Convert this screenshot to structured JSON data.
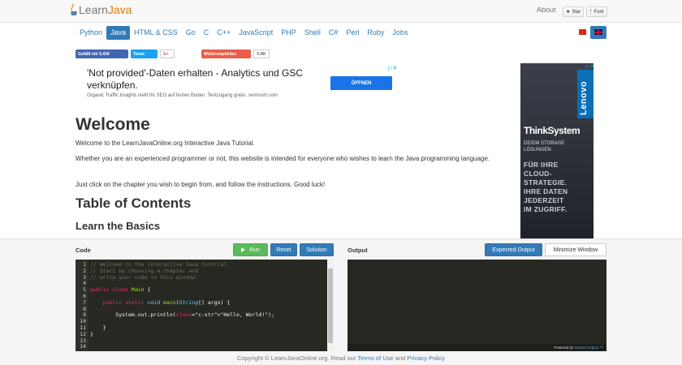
{
  "header": {
    "logo_learn": "Learn",
    "logo_java": "Java",
    "about": "About",
    "star": "Star",
    "fork": "Fork"
  },
  "languages": [
    "Python",
    "Java",
    "HTML & CSS",
    "Go",
    "C",
    "C++",
    "JavaScript",
    "PHP",
    "Shell",
    "C#",
    "Perl",
    "Ruby",
    "Jobs"
  ],
  "active_language": "Java",
  "social": {
    "facebook": "Gefällt mir 5.434",
    "twitter": "Tweet",
    "gplus": "G+",
    "xing": "Weiterempfehlen",
    "xing_count": "5.8K"
  },
  "ad_top": {
    "title": "'Not provided'-Daten erhalten - Analytics und GSC verknüpfen.",
    "subtitle": "Organic Traffic Insights stellt Ihr SEO auf festen Boden. Testzugang gratis. semrush.com",
    "button": "ÖFFNEN"
  },
  "content": {
    "title": "Welcome",
    "p1": "Welcome to the LearnJavaOnline.org Interactive Java Tutorial.",
    "p2": "Whether you are an experienced programmer or not, this website is intended for everyone who wishes to learn the Java programming language.",
    "p3": "Just click on the chapter you wish to begin from, and follow the instructions. Good luck!",
    "toc": "Table of Contents",
    "basics": "Learn the Basics"
  },
  "side_ad": {
    "brand": "Lenovo",
    "product": "ThinkSystem",
    "sub1": "DE/DM STORAGE",
    "sub2": "LÖSUNGEN",
    "slogan1": "FÜR IHRE",
    "slogan2": "CLOUD-",
    "slogan3": "STRATEGIE.",
    "slogan4": "IHRE DATEN",
    "slogan5": "JEDERZEIT",
    "slogan6": "IM ZUGRIFF."
  },
  "editor": {
    "code_label": "Code",
    "output_label": "Output",
    "run": "Run",
    "reset": "Reset",
    "solution": "Solution",
    "expected": "Expected Output",
    "minimize": "Minimize Window",
    "powered": "Powered by",
    "powered_link": "Sphere Engine ™",
    "lines": [
      {
        "n": "1",
        "text": "// Welcome to the interactive Java tutorial."
      },
      {
        "n": "2",
        "text": "// Start by choosing a chapter and"
      },
      {
        "n": "3",
        "text": "// write your code in this window."
      },
      {
        "n": "4",
        "text": ""
      },
      {
        "n": "5",
        "text": "public class Main {"
      },
      {
        "n": "6",
        "text": ""
      },
      {
        "n": "7",
        "text": "    public static void main(String[] args) {"
      },
      {
        "n": "8",
        "text": ""
      },
      {
        "n": "9",
        "text": "        System.out.println(\"Hello, World!\");"
      },
      {
        "n": "10",
        "text": ""
      },
      {
        "n": "11",
        "text": "    }"
      },
      {
        "n": "12",
        "text": "}"
      },
      {
        "n": "13",
        "text": ""
      },
      {
        "n": "14",
        "text": ""
      }
    ]
  },
  "footer": {
    "copyright": "Copyright © LearnJavaOnline.org. Read our",
    "terms": "Terms of Use",
    "and": "and",
    "privacy": "Privacy Policy"
  },
  "colors": {
    "primary": "#337ab7",
    "run_green": "#5cb85c",
    "editor_bg": "#272822",
    "java_orange": "#e07b00"
  }
}
